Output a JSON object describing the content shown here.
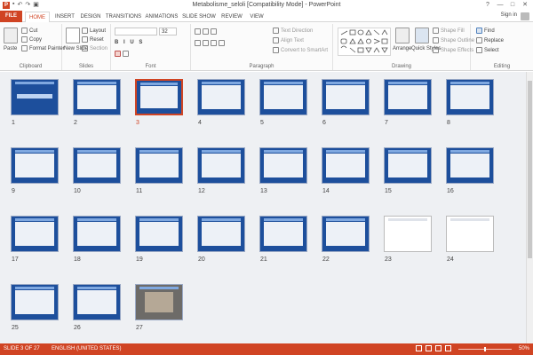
{
  "window": {
    "title": "Metabolisme_seloli [Compatibility Mode] - PowerPoint",
    "controls": [
      "?",
      "—",
      "□",
      "✕"
    ]
  },
  "tabs": {
    "file": "FILE",
    "items": [
      "HOME",
      "INSERT",
      "DESIGN",
      "TRANSITIONS",
      "ANIMATIONS",
      "SLIDE SHOW",
      "REVIEW",
      "VIEW"
    ],
    "active": "HOME",
    "signin": "Sign in"
  },
  "ribbon": {
    "clipboard": {
      "label": "Clipboard",
      "paste": "Paste",
      "cut": "Cut",
      "copy": "Copy",
      "format_painter": "Format Painter"
    },
    "slides": {
      "label": "Slides",
      "new_slide": "New Slide",
      "layout": "Layout",
      "reset": "Reset",
      "section": "Section"
    },
    "font": {
      "label": "Font",
      "size_value": "32"
    },
    "paragraph": {
      "label": "Paragraph",
      "text_direction": "Text Direction",
      "align_text": "Align Text",
      "convert_smartart": "Convert to SmartArt"
    },
    "drawing": {
      "label": "Drawing",
      "arrange": "Arrange",
      "quick_styles": "Quick Styles",
      "shape_fill": "Shape Fill",
      "shape_outline": "Shape Outline",
      "shape_effects": "Shape Effects"
    },
    "editing": {
      "label": "Editing",
      "find": "Find",
      "replace": "Replace",
      "select": "Select"
    }
  },
  "slides": [
    {
      "n": "1"
    },
    {
      "n": "2"
    },
    {
      "n": "3"
    },
    {
      "n": "4"
    },
    {
      "n": "5"
    },
    {
      "n": "6"
    },
    {
      "n": "7"
    },
    {
      "n": "8"
    },
    {
      "n": "9"
    },
    {
      "n": "10"
    },
    {
      "n": "11"
    },
    {
      "n": "12"
    },
    {
      "n": "13"
    },
    {
      "n": "14"
    },
    {
      "n": "15"
    },
    {
      "n": "16"
    },
    {
      "n": "17"
    },
    {
      "n": "18"
    },
    {
      "n": "19"
    },
    {
      "n": "20"
    },
    {
      "n": "21"
    },
    {
      "n": "22"
    },
    {
      "n": "23"
    },
    {
      "n": "24"
    },
    {
      "n": "25"
    },
    {
      "n": "26"
    },
    {
      "n": "27"
    }
  ],
  "selected_slide": "3",
  "status": {
    "slide_info": "SLIDE 3 OF 27",
    "language": "ENGLISH (UNITED STATES)",
    "zoom": "50%",
    "zoom_level_percent": 50
  },
  "colors": {
    "accent": "#d04423",
    "slide_blue": "#1d4f9c"
  }
}
